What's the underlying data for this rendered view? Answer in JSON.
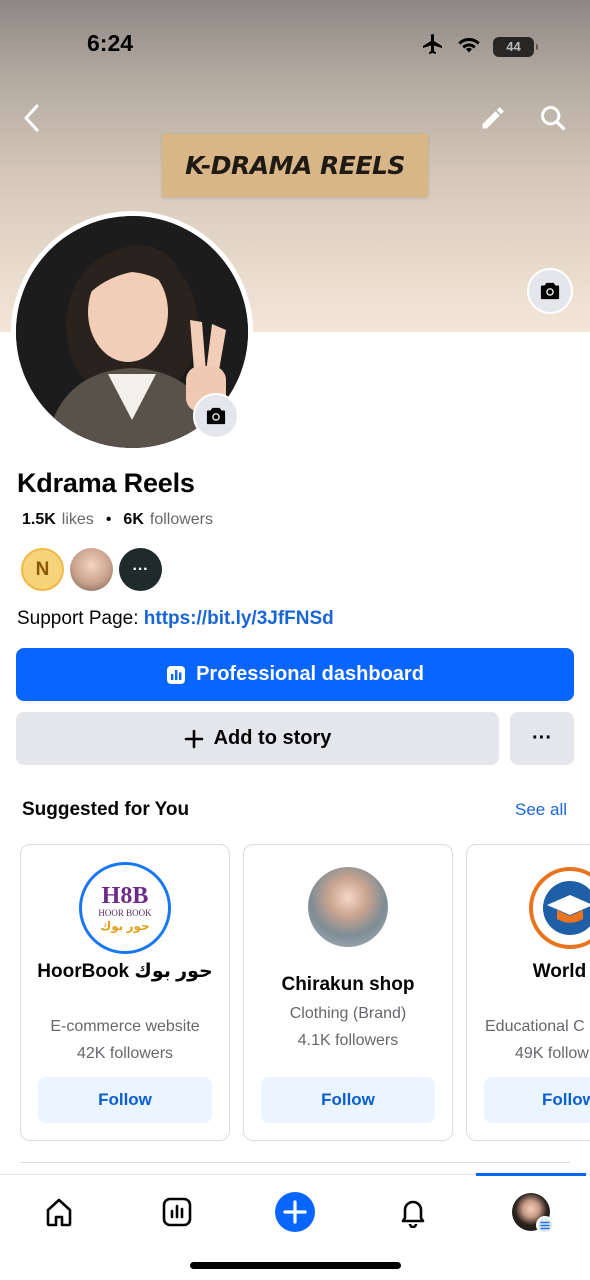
{
  "status_bar": {
    "time": "6:24",
    "battery": "44"
  },
  "cover": {
    "sign_text": "K-DRAMA REELS"
  },
  "profile": {
    "name": "Kdrama Reels",
    "likes_count": "1.5K",
    "likes_label": "likes",
    "separator": "•",
    "followers_count": "6K",
    "followers_label": "followers",
    "circle_initial": "N",
    "more_dots": "···",
    "support_label": "Support Page:",
    "support_link": "https://bit.ly/3JfFNSd"
  },
  "actions": {
    "dashboard_label": "Professional dashboard",
    "add_story_label": "Add to story",
    "more_label": "···"
  },
  "suggested": {
    "title": "Suggested for You",
    "see_all": "See all",
    "cards": [
      {
        "name": "HoorBook حور بوك",
        "logo_top": "H8B",
        "logo_mid": "HOOR BOOK",
        "logo_arabic": "حور بوك",
        "category": "E-commerce website",
        "followers": "42K followers",
        "follow_label": "Follow"
      },
      {
        "name": "Chirakun shop",
        "category": "Clothing (Brand)",
        "followers": "4.1K followers",
        "follow_label": "Follow"
      },
      {
        "name": "World Education",
        "category": "Educational C",
        "followers": "49K follow",
        "follow_label": "Follow"
      }
    ]
  },
  "colors": {
    "accent": "#0866ff",
    "link": "#1a66d6",
    "follow_bg": "#ebf5ff",
    "secondary_bg": "#e4e6eb"
  }
}
